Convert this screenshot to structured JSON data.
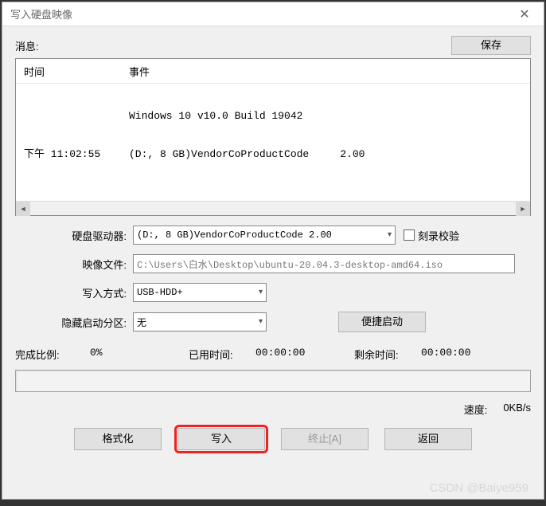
{
  "window": {
    "title": "写入硬盘映像"
  },
  "info_row": {
    "label": "消息:",
    "save_label": "保存"
  },
  "log": {
    "col_time": "时间",
    "col_event": "事件",
    "rows": [
      {
        "time": "",
        "event": "Windows 10 v10.0 Build 19042"
      },
      {
        "time": "下午 11:02:55",
        "event": "(D:, 8 GB)VendorCoProductCode     2.00"
      }
    ]
  },
  "fields": {
    "drive_label": "硬盘驱动器:",
    "drive_value": "(D:, 8 GB)VendorCoProductCode     2.00",
    "verify_label": "刻录校验",
    "image_label": "映像文件:",
    "image_value": "C:\\Users\\白水\\Desktop\\ubuntu-20.04.3-desktop-amd64.iso",
    "write_mode_label": "写入方式:",
    "write_mode_value": "USB-HDD+",
    "hidden_label": "隐藏启动分区:",
    "hidden_value": "无",
    "quickboot_label": "便捷启动"
  },
  "progress": {
    "done_label": "完成比例:",
    "done_value": "0%",
    "elapsed_label": "已用时间:",
    "elapsed_value": "00:00:00",
    "remain_label": "剩余时间:",
    "remain_value": "00:00:00",
    "speed_label": "速度:",
    "speed_value": "0KB/s"
  },
  "buttons": {
    "format": "格式化",
    "write": "写入",
    "stop": "终止[A]",
    "back": "返回"
  },
  "watermark": "CSDN @Baiye959"
}
